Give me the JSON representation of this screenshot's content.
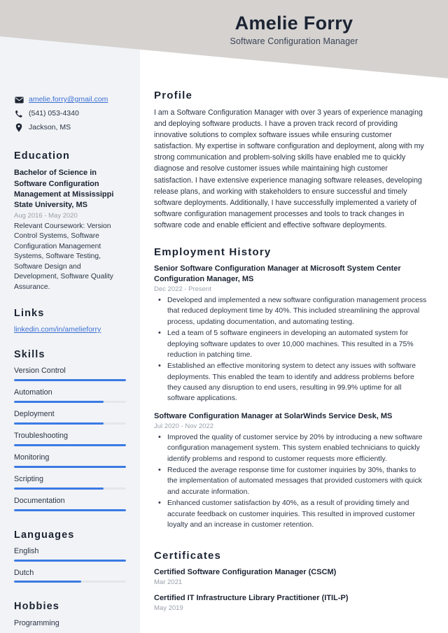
{
  "header": {
    "name": "Amelie Forry",
    "job_title": "Software Configuration Manager",
    "band_color": "#d5d2d0",
    "name_color": "#1c2433"
  },
  "theme": {
    "accent": "#3b7ae4",
    "link": "#3b6fd4",
    "sidebar_bg": "#f1f3f6",
    "muted_text": "#9aa0ab",
    "body_text": "#2b3445"
  },
  "sidebar": {
    "contact": [
      {
        "icon": "envelope-icon",
        "text": "amelie.forry@gmail.com",
        "is_link": true
      },
      {
        "icon": "phone-icon",
        "text": "(541) 053-4340",
        "is_link": false
      },
      {
        "icon": "location-pin-icon",
        "text": "Jackson, MS",
        "is_link": false
      }
    ],
    "education": {
      "heading": "Education",
      "degree": "Bachelor of Science in Software Configuration Management at Mississippi State University, MS",
      "date": "Aug 2016 - May 2020",
      "description": "Relevant Coursework: Version Control Systems, Software Configuration Management Systems, Software Testing, Software Design and Development, Software Quality Assurance."
    },
    "links": {
      "heading": "Links",
      "items": [
        {
          "label": "linkedin.com/in/amelieforry"
        }
      ]
    },
    "skills": {
      "heading": "Skills",
      "items": [
        {
          "label": "Version Control",
          "level": 100
        },
        {
          "label": "Automation",
          "level": 80
        },
        {
          "label": "Deployment",
          "level": 80
        },
        {
          "label": "Troubleshooting",
          "level": 100
        },
        {
          "label": "Monitoring",
          "level": 100
        },
        {
          "label": "Scripting",
          "level": 80
        },
        {
          "label": "Documentation",
          "level": 100
        }
      ]
    },
    "languages": {
      "heading": "Languages",
      "items": [
        {
          "label": "English",
          "level": 100
        },
        {
          "label": "Dutch",
          "level": 60
        }
      ]
    },
    "hobbies": {
      "heading": "Hobbies",
      "items": [
        {
          "label": "Programming"
        }
      ]
    }
  },
  "main": {
    "profile": {
      "heading": "Profile",
      "text": "I am a Software Configuration Manager with over 3 years of experience managing and deploying software products. I have a proven track record of providing innovative solutions to complex software issues while ensuring customer satisfaction. My expertise in software configuration and deployment, along with my strong communication and problem-solving skills have enabled me to quickly diagnose and resolve customer issues while maintaining high customer satisfaction. I have extensive experience managing software releases, developing release plans, and working with stakeholders to ensure successful and timely software deployments. Additionally, I have successfully implemented a variety of software configuration management processes and tools to track changes in software code and enable efficient and effective software deployments."
    },
    "employment": {
      "heading": "Employment History",
      "jobs": [
        {
          "title": "Senior Software Configuration Manager at Microsoft System Center Configuration Manager, MS",
          "date": "Dec 2022 - Present",
          "bullets": [
            "Developed and implemented a new software configuration management process that reduced deployment time by 40%. This included streamlining the approval process, updating documentation, and automating testing.",
            "Led a team of 5 software engineers in developing an automated system for deploying software updates to over 10,000 machines. This resulted in a 75% reduction in patching time.",
            "Established an effective monitoring system to detect any issues with software deployments. This enabled the team to identify and address problems before they caused any disruption to end users, resulting in 99.9% uptime for all software applications."
          ]
        },
        {
          "title": "Software Configuration Manager at SolarWinds Service Desk, MS",
          "date": "Jul 2020 - Nov 2022",
          "bullets": [
            "Improved the quality of customer service by 20% by introducing a new software configuration management system. This system enabled technicians to quickly identify problems and respond to customer requests more efficiently.",
            "Reduced the average response time for customer inquiries by 30%, thanks to the implementation of automated messages that provided customers with quick and accurate information.",
            "Enhanced customer satisfaction by 40%, as a result of providing timely and accurate feedback on customer inquiries. This resulted in improved customer loyalty and an increase in customer retention."
          ]
        }
      ]
    },
    "certificates": {
      "heading": "Certificates",
      "items": [
        {
          "name": "Certified Software Configuration Manager (CSCM)",
          "date": "Mar 2021"
        },
        {
          "name": "Certified IT Infrastructure Library Practitioner (ITIL-P)",
          "date": "May 2019"
        }
      ]
    }
  }
}
